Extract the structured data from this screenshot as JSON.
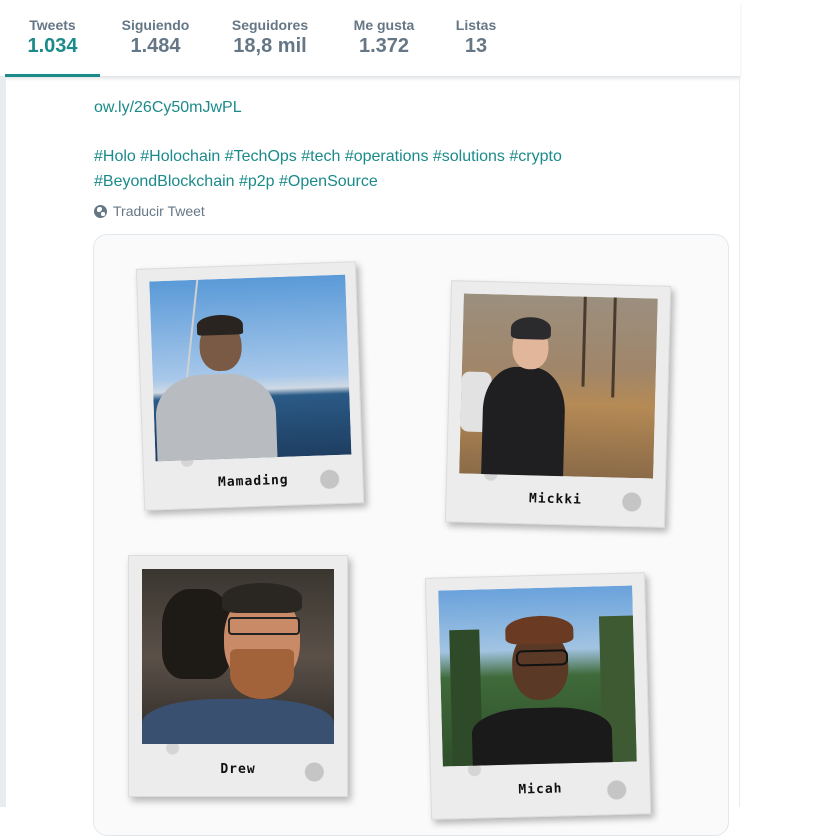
{
  "profile_nav": {
    "tabs": [
      {
        "label": "Tweets",
        "value": "1.034",
        "active": true
      },
      {
        "label": "Siguiendo",
        "value": "1.484"
      },
      {
        "label": "Seguidores",
        "value": "18,8 mil"
      },
      {
        "label": "Me gusta",
        "value": "1.372"
      },
      {
        "label": "Listas",
        "value": "13"
      }
    ]
  },
  "tweet": {
    "link": "ow.ly/26Cy50mJwPL",
    "hashtags_line1": "#Holo #Holochain #TechOps #tech #operations #solutions #crypto",
    "hashtags_line2": "#BeyondBlockchain #p2p #OpenSource",
    "translate_label": "Traducir Tweet",
    "translate_icon": "globe-icon"
  },
  "media": {
    "photos": [
      {
        "caption": "Mamading"
      },
      {
        "caption": "Mickki"
      },
      {
        "caption": "Drew"
      },
      {
        "caption": "Micah"
      }
    ]
  },
  "colors": {
    "accent": "#1b8a8a",
    "muted": "#657786",
    "border": "#e1e8ed"
  }
}
